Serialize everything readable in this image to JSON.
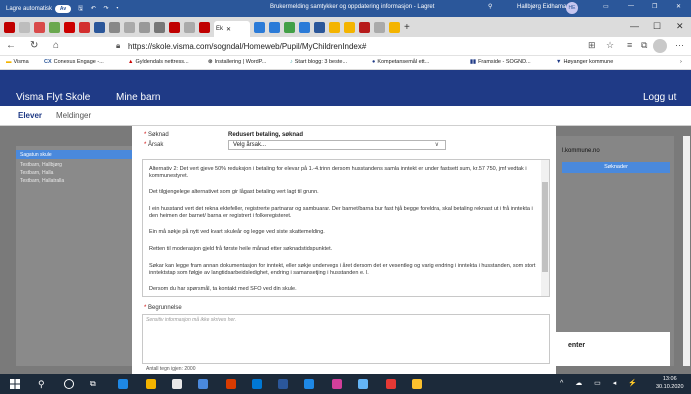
{
  "word": {
    "autosave": "Lagre automatisk",
    "autosave_state": "Av",
    "title": "Brukermelding samtykker og oppdatering informasjon - Lagret",
    "user": "Hallbjørg Eidhamar",
    "avatar": "HE"
  },
  "browser": {
    "url": "https://skole.visma.com/sogndal/Homeweb/Pupil/MyChildrenIndex#",
    "active_tab_label": "Ek",
    "favorites": [
      {
        "icon": "visma-icon",
        "label": "Visma"
      },
      {
        "icon": "cx-icon",
        "label": "Conexus Engage -..."
      },
      {
        "icon": "gyldendal-icon",
        "label": "Gyldendals nettress..."
      },
      {
        "icon": "wordpress-icon",
        "label": "Installering | WordP..."
      },
      {
        "icon": "blog-icon",
        "label": "Start blogg: 3 beste..."
      },
      {
        "icon": "kompetanse-icon",
        "label": "Kompetansemål ett..."
      },
      {
        "icon": "framside-icon",
        "label": "Framside - SOGND..."
      },
      {
        "icon": "hoyanger-icon",
        "label": "Høyanger kommune"
      }
    ]
  },
  "app": {
    "title": "Visma Flyt Skole",
    "nav": "Mine barn",
    "logout": "Logg ut",
    "subnav": [
      "Elever",
      "Meldinger"
    ]
  },
  "sidebar": {
    "selected": "Sagatun skule",
    "items": [
      "Testbarn, Hallbjørg",
      "Testbarn, Halla",
      "Testbarn, Hallatralla"
    ]
  },
  "right_panel": {
    "email": "l.kommune.no",
    "button": "Søknader",
    "lower_heading": "enter"
  },
  "modal": {
    "soknad_label": "Søknad",
    "soknad_value": "Redusert betaling, søknad",
    "arsak_label": "Årsak",
    "arsak_value": "Velg årsak...",
    "info": [
      "Alternativ 2: Det vert gjeve 50% reduksjon i betaling for elevar på 1.-4.trinn dersom husstandens samla inntekt er under fastsett sum, kr.57 750, jmf vedtak i kommunestyret.",
      "Det tilgjengelege alternativet som gir lågast betaling vert lagt til grunn.",
      "I ein husstand vert det rekna ektefeller, registrerte partnarar og sambuarar. Der barnet/barna bur fast hjå begge foreldra, skal betaling reknast ut i frå inntekta i den heimen der barnet/ barna er registrert i folkeregisteret.",
      "Ein må søkje på nytt ved kvart skuleår og legge ved siste skattemelding.",
      "Retten til moderasjon gjeld frå første heile månad etter søknadstidspunktet.",
      "Søkar kan legge fram annan dokumentasjon for inntekt, eller søkje undervegs i året dersom det er vesentleg og varig endring i inntekta i husstanden, som stort inntektstap som følgje av langtidsarbeidsledighet, endring i samansetjing i husstanden e. l.",
      "Dersom du har spørsmål, ta kontakt med SFO ved din skule."
    ],
    "begrunnelse_label": "Begrunnelse",
    "begrunnelse_placeholder": "Sensitiv informasjon må ikke skrives her.",
    "counter": "Antall tegn igjen: 2000"
  },
  "taskbar": {
    "time": "13:06",
    "date": "30.10.2020"
  },
  "colors": {
    "word_blue": "#2b579a",
    "visma_navy": "#1f3a86",
    "accent_blue": "#4a89dc"
  }
}
